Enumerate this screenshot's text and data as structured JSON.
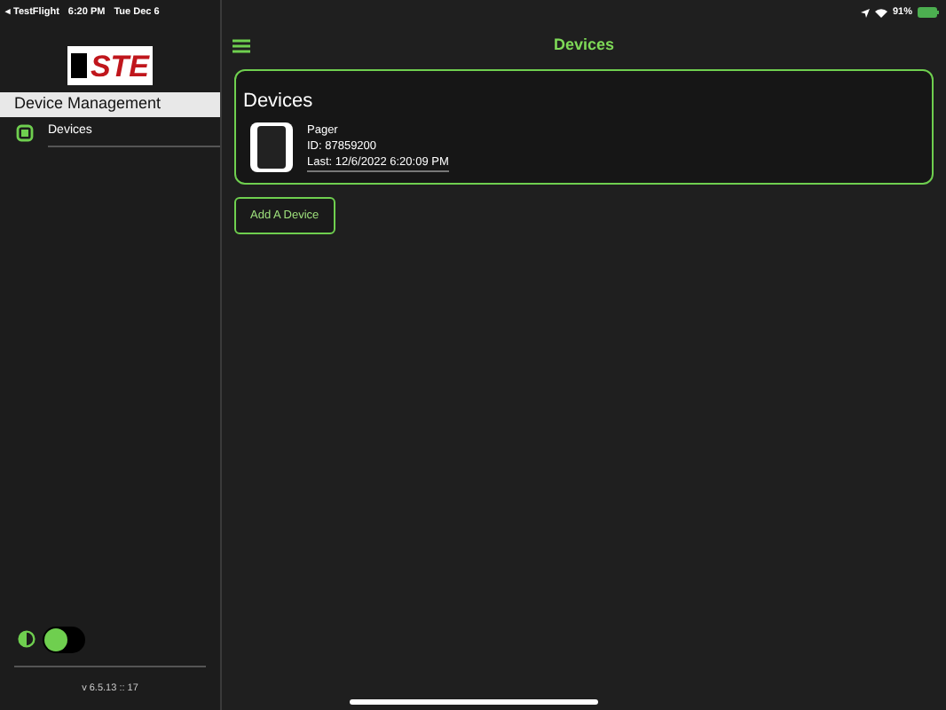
{
  "status_bar": {
    "back_app": "◂ TestFlight",
    "time": "6:20 PM",
    "date": "Tue Dec 6",
    "battery": "91%"
  },
  "sidebar": {
    "logo": "STE",
    "section": "Device Management",
    "items": [
      {
        "label": "Devices",
        "selected": true
      }
    ],
    "theme_toggle": {
      "on": false
    },
    "version": "v 6.5.13 :: 17"
  },
  "header": {
    "title": "Devices"
  },
  "card": {
    "title": "Devices",
    "devices": [
      {
        "name": "Pager",
        "id": "ID: 87859200",
        "last": "Last: 12/6/2022 6:20:09 PM"
      }
    ]
  },
  "add_button": "Add A Device"
}
